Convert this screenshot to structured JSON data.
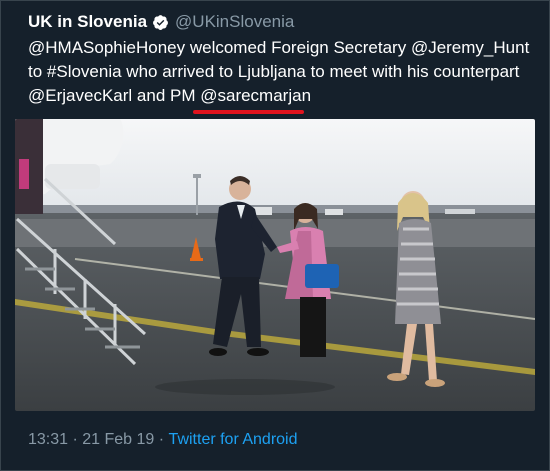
{
  "tweet": {
    "display_name": "UK in Slovenia",
    "verified_icon": "verified-badge-icon",
    "handle": "@UKinSlovenia",
    "text_parts": [
      {
        "t": "@HMASophieHoney",
        "k": "mention"
      },
      {
        "t": " welcomed Foreign Secretary ",
        "k": "text"
      },
      {
        "t": "@Jeremy_Hunt",
        "k": "mention"
      },
      {
        "t": " to ",
        "k": "text"
      },
      {
        "t": "#Slovenia",
        "k": "hashtag"
      },
      {
        "t": " who arrived to Ljubljana to meet with his counterpart ",
        "k": "text"
      },
      {
        "t": "@ErjavecKarl",
        "k": "mention"
      },
      {
        "t": " and PM ",
        "k": "text"
      },
      {
        "t": "@sarecmarjan",
        "k": "mention"
      }
    ],
    "time": "13:31",
    "separator": " · ",
    "date": "21 Feb 19",
    "source": "Twitter for Android"
  },
  "colors": {
    "background": "#15202b",
    "secondary_text": "#8899a6",
    "link": "#1da1f2",
    "highlight_underline": "#e0141e"
  }
}
